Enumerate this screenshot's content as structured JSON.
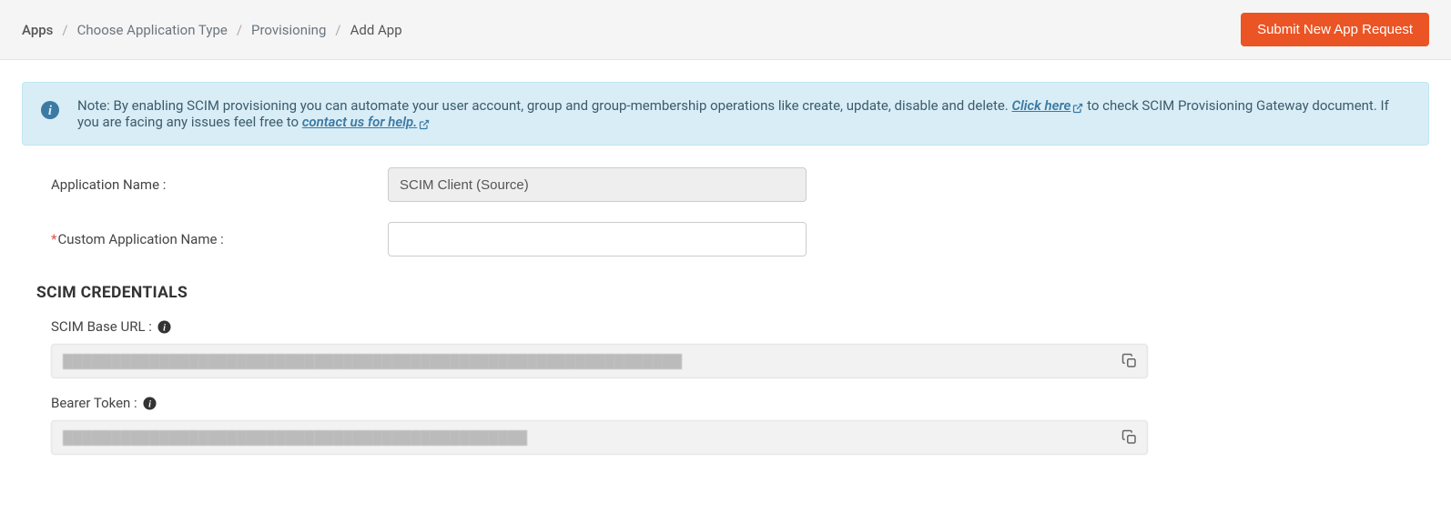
{
  "breadcrumb": {
    "items": [
      "Apps",
      "Choose Application Type",
      "Provisioning",
      "Add App"
    ]
  },
  "header": {
    "submit_label": "Submit New App Request"
  },
  "info": {
    "prefix": "Note: By enabling SCIM provisioning you can automate your user account, group and group-membership operations like create, update, disable and delete. ",
    "click_here": "Click here",
    "middle": " to check SCIM Provisioning Gateway document. If you are facing any issues feel free to ",
    "contact": "contact us for help."
  },
  "form": {
    "app_name_label": "Application Name :",
    "app_name_value": "SCIM Client (Source)",
    "custom_name_label": "Custom Application Name :",
    "custom_name_value": ""
  },
  "credentials": {
    "heading": "SCIM CREDENTIALS",
    "base_url_label": "SCIM Base URL :",
    "base_url_value": "████████████████████████████████████████████████████████████████",
    "bearer_label": "Bearer Token :",
    "bearer_value": "████████████████████████████████████████████████"
  }
}
